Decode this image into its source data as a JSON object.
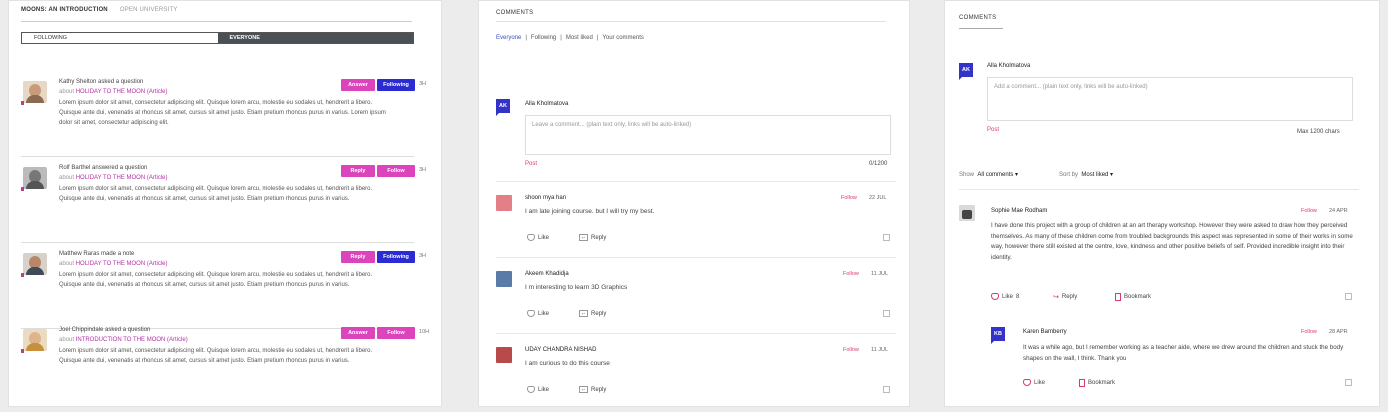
{
  "panel1": {
    "course": "MOONS: AN INTRODUCTION",
    "university": "OPEN UNIVERSITY",
    "tabs": [
      "FOLLOWING",
      "EVERYONE"
    ],
    "lorem": "Lorem ipsum dolor sit amet, consectetur adipiscing elit. Quisque lorem arcu, molestie eu sodales ut, hendrerit a libero. Quisque ante dui, venenatis at rhoncus sit amet, cursus sit amet justo. Etiam pretium rhoncus purus in varius. Lorem ipsum dolor sit amet, consectetur adipiscing elit.",
    "lorem_short": "Lorem ipsum dolor sit amet, consectetur adipiscing elit. Quisque lorem arcu, molestie eu sodales ut, hendrerit a libero. Quisque ante dui, venenatis at rhoncus sit amet, cursus sit amet justo. Etiam pretium rhoncus purus in varius.",
    "items": [
      {
        "title": "Kathy Shelton asked a question",
        "about": "about",
        "link": "HOLIDAY TO THE MOON (Article)",
        "btn1": "Answer",
        "btn2": "Following",
        "time": "3H"
      },
      {
        "title": "Rolf Barthel answered a question",
        "about": "about",
        "link": "HOLIDAY TO THE MOON (Article)",
        "btn1": "Reply",
        "btn2": "Follow",
        "time": "3H"
      },
      {
        "title": "Matthew Raras made a note",
        "about": "about",
        "link": "HOLIDAY TO THE MOON (Article)",
        "btn1": "Reply",
        "btn2": "Following",
        "time": "3H"
      },
      {
        "title": "Joel Chippindale asked a question",
        "about": "about",
        "link": "INTRODUCTION TO THE MOON (Article)",
        "btn1": "Answer",
        "btn2": "Follow",
        "time": "10H"
      }
    ]
  },
  "panel2": {
    "title": "COMMENTS",
    "tabs": [
      "Everyone",
      "|",
      "Following",
      "|",
      "Most liked",
      "|",
      "Your comments"
    ],
    "user_initials": "AK",
    "user_name": "Alla Kholmatova",
    "placeholder": "Leave a comment... (plain text only, links will be auto-linked)",
    "post": "Post",
    "counter": "0/1200",
    "like": "Like",
    "reply": "Reply",
    "follow": "Follow",
    "comments": [
      {
        "name": "shoon mya han",
        "date": "22 JUL",
        "text": "I am late joining course. but I will try my best."
      },
      {
        "name": "Akeem Khadidja",
        "date": "11 JUL",
        "text": "I m interesting to learn 3D Graphics"
      },
      {
        "name": "UDAY CHANDRA NISHAD",
        "date": "11 JUL",
        "text": "I am curious to do this course"
      }
    ]
  },
  "panel3": {
    "title": "COMMENTS",
    "user_initials": "AK",
    "user_name": "Alla Kholmatova",
    "placeholder": "Add a comment... (plain text only, links will be auto-linked)",
    "post": "Post",
    "max": "Max 1200 chars",
    "show_label": "Show",
    "show_value": "All comments ▾",
    "sort_label": "Sort by",
    "sort_value": "Most liked ▾",
    "comment": {
      "name": "Sophie Mae Rodham",
      "follow": "Follow",
      "date": "24 APR",
      "text": "I have done this project with a group of children at an art therapy workshop. However they were asked to draw how they perceived themselves. As many of these children come from troubled backgrounds this aspect was represented in some of their works in some way, however there still existed at the centre, love, kindness and other positive beliefs of self. Provided incredible insight into their identity.",
      "like": "Like",
      "like_count": "8",
      "reply": "Reply",
      "bookmark": "Bookmark"
    },
    "reply_comment": {
      "initials": "KB",
      "name": "Karen Bamberry",
      "follow": "Follow",
      "date": "28 APR",
      "text": "It was a while ago, but I remember working as a teacher aide, where we drew around the children and stuck the body shapes on the wall, I think. Thank you",
      "like": "Like",
      "bookmark": "Bookmark"
    }
  }
}
